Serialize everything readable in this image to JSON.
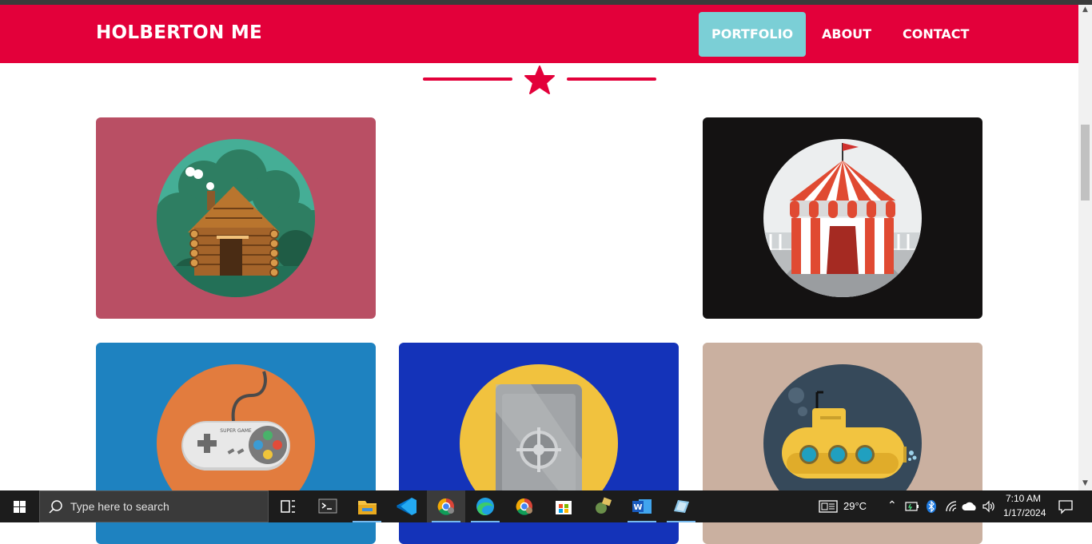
{
  "header": {
    "brand": "HOLBERTON ME",
    "nav": [
      "PORTFOLIO",
      "ABOUT",
      "CONTACT"
    ],
    "active_nav": "PORTFOLIO",
    "color_primary": "#e3003a",
    "color_active": "#7bcfd6"
  },
  "portfolio": {
    "items": [
      {
        "name": "cabin",
        "bg": "#b94f64"
      },
      {
        "name": "circus",
        "bg": "#141212"
      },
      {
        "name": "game-controller",
        "bg": "#1e82c0"
      },
      {
        "name": "safe",
        "bg": "#1433b9"
      },
      {
        "name": "submarine",
        "bg": "#cab0a0"
      }
    ]
  },
  "taskbar": {
    "search_placeholder": "Type here to search",
    "weather": "29°C",
    "time": "7:10 AM",
    "date": "1/17/2024",
    "controller_label": "SUPER GAME"
  }
}
